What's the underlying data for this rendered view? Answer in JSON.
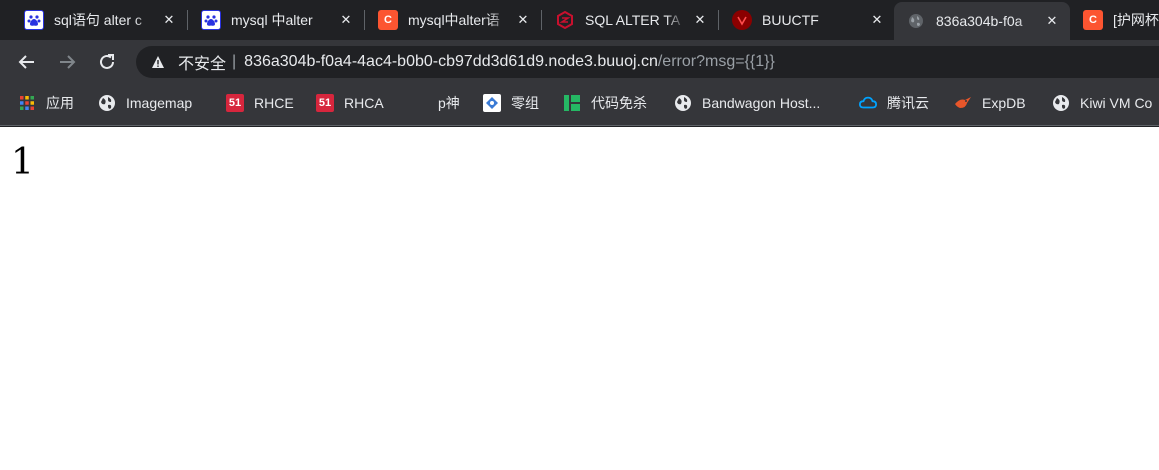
{
  "tabs": [
    {
      "title": "sql语句 alter c",
      "favicon": "baidu-icon",
      "active": false
    },
    {
      "title": "mysql 中alter",
      "favicon": "baidu-icon",
      "active": false
    },
    {
      "title": "mysql中alter语",
      "favicon": "csdn-icon",
      "active": false
    },
    {
      "title": "SQL ALTER TA",
      "favicon": "runoob-icon",
      "active": false
    },
    {
      "title": "BUUCTF",
      "favicon": "buuctf-icon",
      "active": false
    },
    {
      "title": "836a304b-f0a",
      "favicon": "globe-icon",
      "active": true
    },
    {
      "title": "[护网杯",
      "favicon": "csdn-icon",
      "active": false
    }
  ],
  "toolbar": {
    "security_label": "不安全",
    "url_host": "836a304b-f0a4-4ac4-b0b0-cb97dd3d61d9.node3.buuoj.cn",
    "url_path": "/error?msg={{1}}"
  },
  "bookmarks": [
    {
      "label": "应用",
      "icon": "apps-grid-icon"
    },
    {
      "label": "Imagemap",
      "icon": "globe-icon"
    },
    {
      "label": "RHCE",
      "icon": "51cto-icon"
    },
    {
      "label": "RHCA",
      "icon": "51cto-icon"
    },
    {
      "label": "p神",
      "icon": ""
    },
    {
      "label": "零组",
      "icon": "zero-group-icon"
    },
    {
      "label": "代码免杀",
      "icon": "yuque-icon"
    },
    {
      "label": "Bandwagon Host...",
      "icon": "globe-icon"
    },
    {
      "label": "腾讯云",
      "icon": "tencent-cloud-icon"
    },
    {
      "label": "ExpDB",
      "icon": "expdb-icon"
    },
    {
      "label": "Kiwi VM Co",
      "icon": "globe-icon"
    }
  ],
  "page": {
    "content": "1"
  },
  "colors": {
    "chrome_dark": "#202124",
    "toolbar": "#35363a",
    "text": "#e8eaed",
    "muted": "#9aa0a6",
    "csdn": "#fc5531",
    "51cto": "#d7263d",
    "yuque": "#25b864",
    "tencent": "#00a3ff"
  }
}
